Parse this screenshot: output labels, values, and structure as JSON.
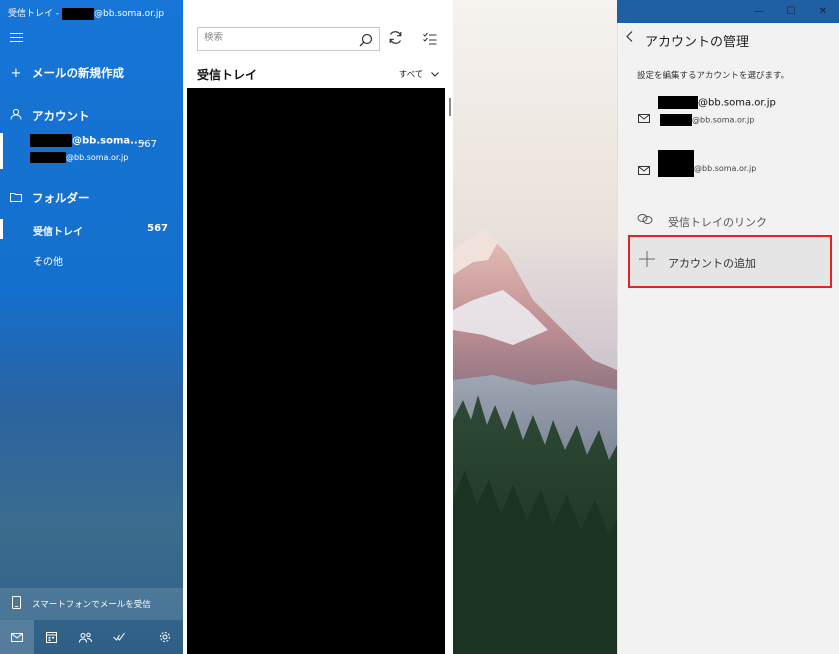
{
  "window": {
    "title_prefix": "受信トレイ - ",
    "title_suffix": "@bb.soma.or.jp",
    "controls": [
      "—",
      "☐",
      "✕"
    ]
  },
  "sidebar": {
    "new_mail": "メールの新規作成",
    "accounts_header": "アカウント",
    "account": {
      "line1_suffix": "@bb.soma....",
      "line2_suffix": "@bb.soma.or.jp",
      "count": "567"
    },
    "folders_header": "フォルダー",
    "folders": [
      {
        "name": "受信トレイ",
        "count": "567"
      },
      {
        "name": "その他",
        "count": ""
      }
    ],
    "phone_promo": "スマートフォンでメールを受信",
    "bottom_icons": [
      "mail-icon",
      "calendar-icon",
      "people-icon",
      "todo-icon",
      "settings-icon"
    ]
  },
  "list": {
    "search_placeholder": "検索",
    "title": "受信トレイ",
    "filter": "すべて"
  },
  "panel": {
    "title": "アカウントの管理",
    "subtitle": "設定を編集するアカウントを選びます。",
    "accounts": [
      {
        "line1_suffix": "@bb.soma.or.jp",
        "line2_suffix": "@bb.soma.or.jp"
      },
      {
        "line1_suffix": "",
        "line2_suffix": "@bb.soma.or.jp"
      }
    ],
    "link_inboxes": "受信トレイのリンク",
    "add_account": "アカウントの追加",
    "highlight_color": "#e02424"
  },
  "colors": {
    "sidebar_blue": "#1675d6",
    "panel_bg": "#f2f2f2"
  }
}
